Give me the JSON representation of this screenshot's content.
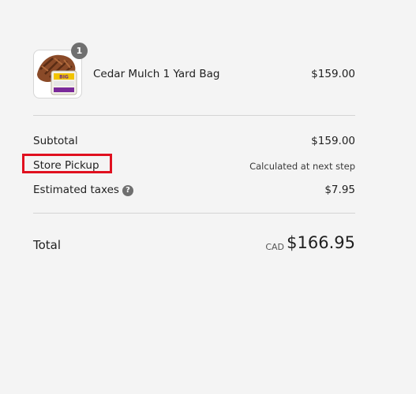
{
  "cart": {
    "items": [
      {
        "name": "Cedar Mulch 1 Yard Bag",
        "price": "$159.00",
        "quantity": "1",
        "image_icon": "cedar-mulch-bag-thumbnail"
      }
    ]
  },
  "summary": {
    "subtotal_label": "Subtotal",
    "subtotal_value": "$159.00",
    "pickup_label": "Store Pickup",
    "pickup_value": "Calculated at next step",
    "taxes_label": "Estimated taxes",
    "taxes_help_icon": "question-circle-icon",
    "taxes_value": "$7.95",
    "total_label": "Total",
    "total_currency": "CAD",
    "total_value": "$166.95"
  },
  "colors": {
    "background": "#f4f4f4",
    "highlight": "#e0101f",
    "badge": "#707070"
  }
}
